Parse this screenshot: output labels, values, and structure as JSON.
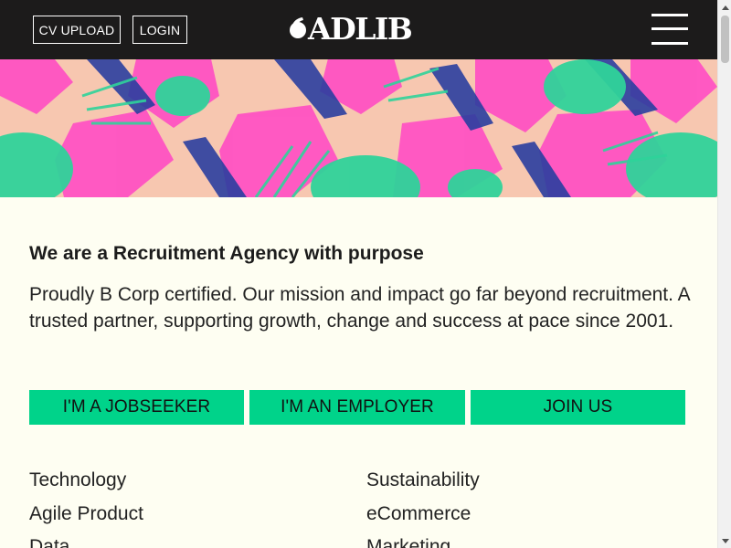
{
  "header": {
    "cv_upload_label": "CV UPLOAD",
    "login_label": "LOGIN",
    "logo_text": "ADLIB",
    "menu_icon": "hamburger-menu-icon",
    "background_color": "#1c1b1b"
  },
  "banner": {
    "image": "tropical-leaves-pattern",
    "colors": [
      "#f7c7b0",
      "#ff4fc3",
      "#2fd39a",
      "#2a3ea0"
    ]
  },
  "main": {
    "headline": "We are a Recruitment Agency with purpose",
    "intro": "Proudly B Corp certified. Our mission and impact go far beyond recruitment. A trusted partner, supporting growth, change and success at pace since 2001.",
    "ctas": [
      {
        "label": "I'M A JOBSEEKER"
      },
      {
        "label": "I'M AN EMPLOYER"
      },
      {
        "label": "JOIN US"
      }
    ],
    "cta_color": "#00d38a",
    "sectors_left": [
      "Technology",
      "Agile Product",
      "Data"
    ],
    "sectors_right": [
      "Sustainability",
      "eCommerce",
      "Marketing"
    ]
  },
  "colors": {
    "page_background": "#fefef2",
    "text": "#1c1c1c"
  }
}
